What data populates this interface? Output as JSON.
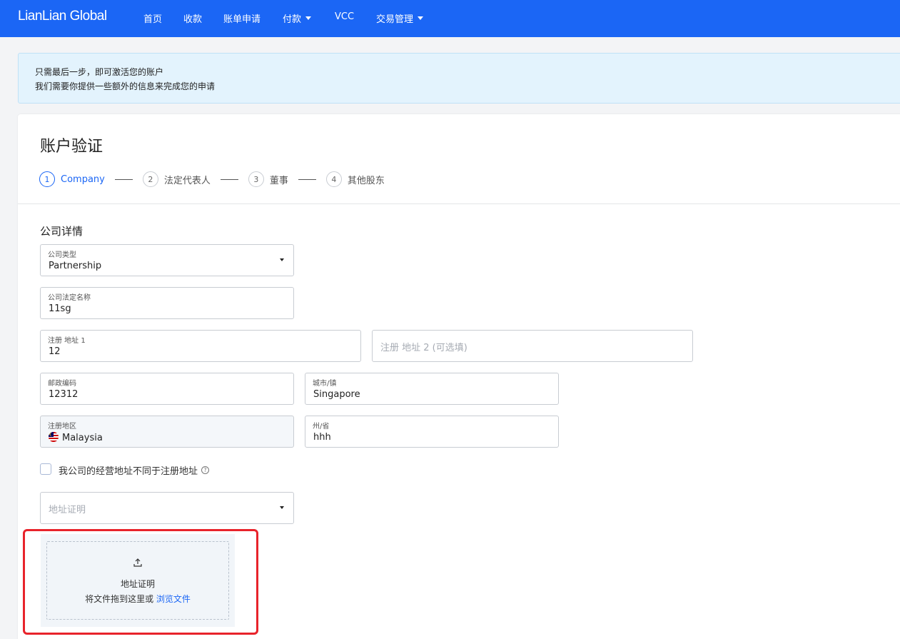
{
  "header": {
    "logo": "LianLian Global",
    "nav": [
      {
        "label": "首页",
        "dropdown": false
      },
      {
        "label": "收款",
        "dropdown": false
      },
      {
        "label": "账单申请",
        "dropdown": false
      },
      {
        "label": "付款",
        "dropdown": true
      },
      {
        "label": "VCC",
        "dropdown": false
      },
      {
        "label": "交易管理",
        "dropdown": true
      }
    ],
    "color": "#1b66f5"
  },
  "notice": {
    "line1": "只需最后一步，即可激活您的账户",
    "line2": "我们需要你提供一些额外的信息来完成您的申请"
  },
  "page": {
    "title": "账户验证",
    "steps": [
      {
        "num": "1",
        "label": "Company",
        "active": true
      },
      {
        "num": "2",
        "label": "法定代表人",
        "active": false
      },
      {
        "num": "3",
        "label": "董事",
        "active": false
      },
      {
        "num": "4",
        "label": "其他股东",
        "active": false
      }
    ],
    "section_title": "公司详情"
  },
  "form": {
    "company_type": {
      "label": "公司类型",
      "value": "Partnership"
    },
    "legal_name": {
      "label": "公司法定名称",
      "value": "11sg"
    },
    "address1": {
      "label": "注册 地址 1",
      "value": "12"
    },
    "address2": {
      "placeholder": "注册 地址 2 (可选填)"
    },
    "postal_code": {
      "label": "邮政编码",
      "value": "12312"
    },
    "city": {
      "label": "城市/镇",
      "value": "Singapore"
    },
    "region": {
      "label": "注册地区",
      "value": "Malaysia",
      "flag_icon": "malaysia-flag-icon"
    },
    "state": {
      "label": "州/省",
      "value": "hhh"
    },
    "different_address_checkbox": {
      "label": "我公司的经营地址不同于注册地址",
      "checked": false
    },
    "address_proof_select": {
      "placeholder": "地址证明"
    },
    "upload": {
      "icon": "upload-icon",
      "title": "地址证明",
      "hint": "将文件拖到这里或",
      "browse_link": "浏览文件"
    }
  }
}
